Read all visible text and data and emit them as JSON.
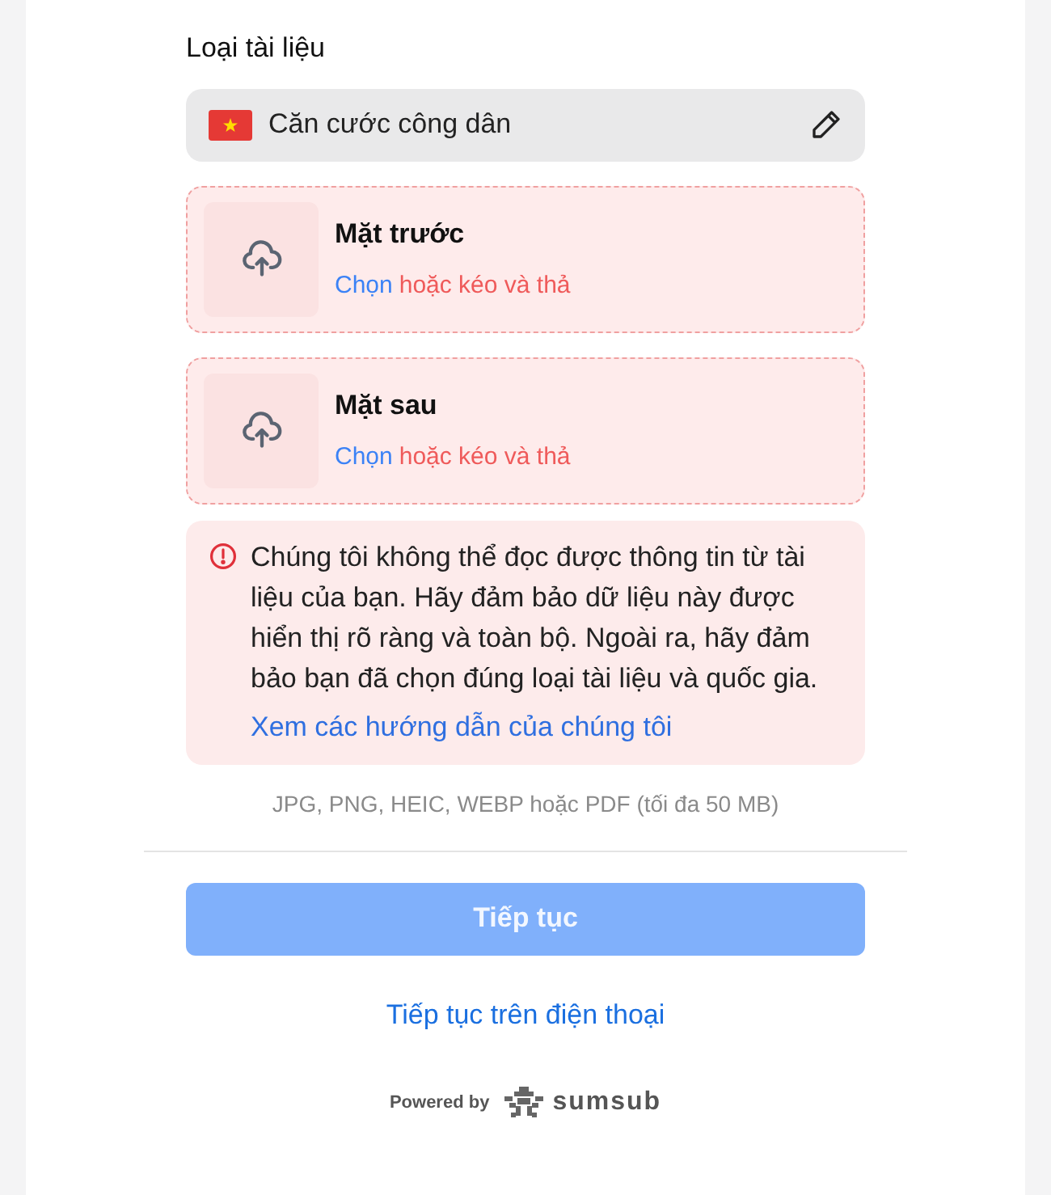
{
  "document_type": {
    "label": "Loại tài liệu",
    "value": "Căn cước công dân"
  },
  "uploads": [
    {
      "title": "Mặt trước",
      "link": "Chọn",
      "hint": "hoặc kéo và thả",
      "error": true
    },
    {
      "title": "Mặt sau",
      "link": "Chọn",
      "hint": "hoặc kéo và thả",
      "error": true
    }
  ],
  "error": {
    "message": "Chúng tôi không thể đọc được thông tin từ tài liệu của bạn. Hãy đảm bảo dữ liệu này được hiển thị rõ ràng và toàn bộ. Ngoài ra, hãy đảm bảo bạn đã chọn đúng loại tài liệu và quốc gia.",
    "link": "Xem các hướng dẫn của chúng tôi"
  },
  "formats": "JPG, PNG, HEIC, WEBP hoặc PDF (tối đa 50 MB)",
  "continue_button": {
    "label": "Tiếp tục",
    "disabled": true
  },
  "phone_link": "Tiếp tục trên điện thoại",
  "footer": {
    "powered_by": "Powered by",
    "brand": "sumsub"
  }
}
